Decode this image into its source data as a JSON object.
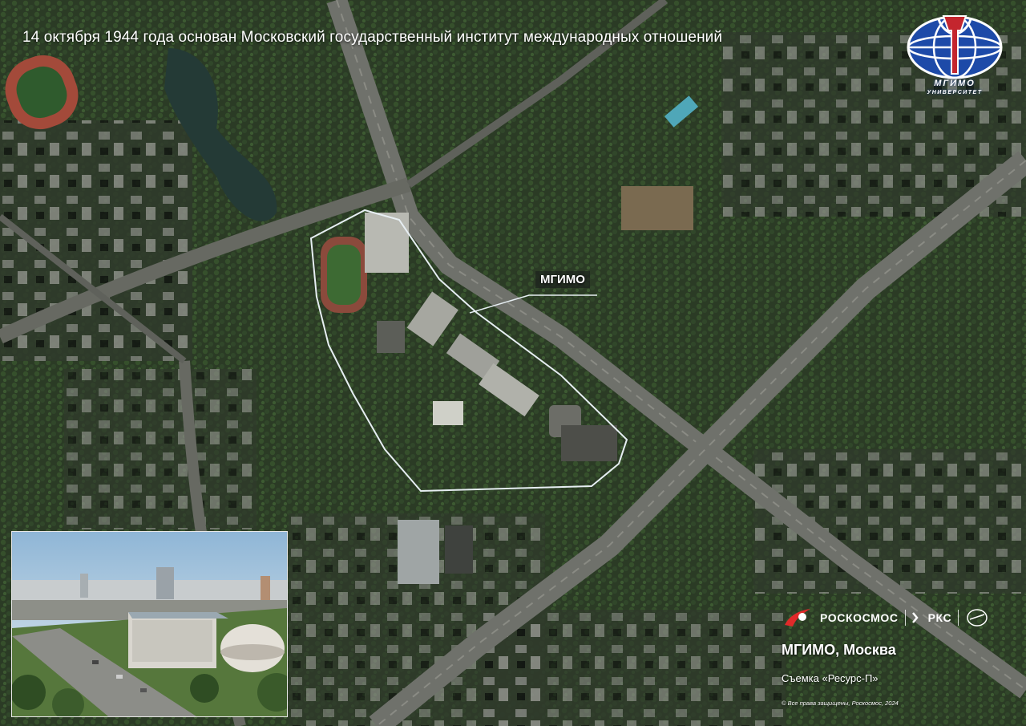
{
  "headline": "14 октября 1944 года основан Московский государственный институт международных отношений",
  "map": {
    "callout_label": "МГИМО",
    "highlight_color": "#e6eef2"
  },
  "logo": {
    "caption": "МГИМО",
    "subcaption": "УНИВЕРСИТЕТ",
    "colors": {
      "globe": "#1d4aa8",
      "emblem": "#c4262e"
    }
  },
  "inset_photo": {
    "description_icon": "building-photo"
  },
  "footer": {
    "brand_roscosmos": "РОСКОСМОС",
    "brand_rks": "РКС",
    "place_title": "МГИМО, Москва",
    "survey_text": "Съемка «Ресурс-П»",
    "copyright": "© Все права защищены, Роскосмос, 2024"
  }
}
